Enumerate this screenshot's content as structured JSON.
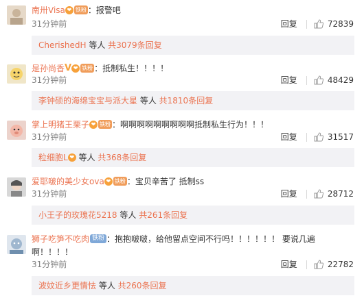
{
  "comments": [
    {
      "user": "南卅Visa",
      "badge": "铁粉",
      "separator": "：",
      "text": "报警吧",
      "time": "31分钟前",
      "reply_label": "回复",
      "likes": "72839",
      "sub_user": "CherishedH",
      "sub_middle": " 等人 ",
      "sub_count": "共3079条回复"
    },
    {
      "user": "是孙尚香",
      "badge": "铁粉",
      "separator": "：",
      "text": "抵制私生！！！！",
      "time": "31分钟前",
      "reply_label": "回复",
      "likes": "48429",
      "sub_user": "李钟硕的海绵宝宝与派大星",
      "sub_middle": " 等人 ",
      "sub_count": "共1810条回复"
    },
    {
      "user": "掌上明猪王栗子",
      "badge": "铁粉",
      "separator": "：",
      "text": "啊啊啊啊啊啊啊啊啊抵制私生行为！！！",
      "time": "31分钟前",
      "reply_label": "回复",
      "likes": "31517",
      "sub_user": "粒细胞L",
      "sub_middle": " 等人 ",
      "sub_count": "共368条回复"
    },
    {
      "user": "爱耶啵的美少女ova",
      "badge": "铁粉",
      "separator": "：",
      "text": "宝贝辛苦了 抵制ss",
      "time": "31分钟前",
      "reply_label": "回复",
      "likes": "28712",
      "sub_user": "小王子的玫瑰花5218",
      "sub_middle": " 等人 ",
      "sub_count": "共261条回复"
    },
    {
      "user": "狮子吃笋不吃肉",
      "badge": "铁粉",
      "separator": "：",
      "text": "抱抱啵啵，给他留点空间不行吗！！！！！！ 要说几遍",
      "text2": "啊！！！！",
      "time": "31分钟前",
      "reply_label": "回复",
      "likes": "22782",
      "sub_user": "波妏近乡更情怯",
      "sub_middle": " 等人 ",
      "sub_count": "共260条回复"
    }
  ]
}
